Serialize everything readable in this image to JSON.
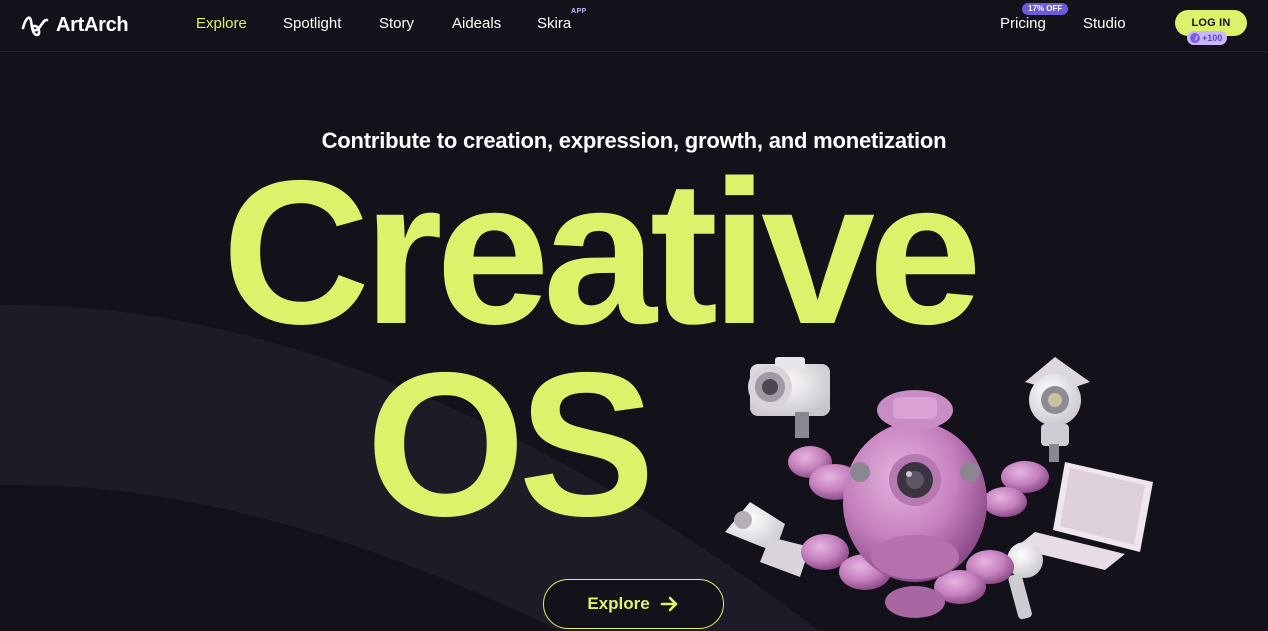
{
  "brand": {
    "name": "ArtArch",
    "logo_icon": "squiggle-logo-icon",
    "accent": "#dcf26a",
    "background": "#13121a"
  },
  "nav": {
    "links": [
      {
        "label": "Explore",
        "active": true
      },
      {
        "label": "Spotlight",
        "active": false
      },
      {
        "label": "Story",
        "active": false
      },
      {
        "label": "Aideals",
        "active": false
      },
      {
        "label": "Skira",
        "active": false
      }
    ],
    "skira_badge": "APP",
    "pricing": {
      "label": "Pricing",
      "badge": "17% OFF"
    },
    "studio": {
      "label": "Studio"
    },
    "login": {
      "label": "LOG IN",
      "points": "+100"
    }
  },
  "hero": {
    "subtitle": "Contribute to creation, expression, growth, and monetization",
    "line1": "Creative",
    "line2": "OS",
    "cta": {
      "label": "Explore",
      "icon": "arrow-right-icon"
    },
    "illustration": "pink-robot-with-camera-light-laptop-microphone"
  }
}
